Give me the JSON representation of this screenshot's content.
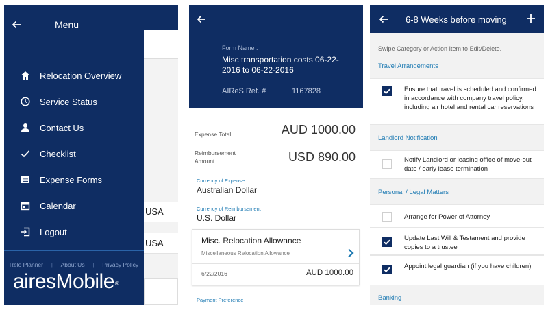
{
  "screen1": {
    "menu_title": "Menu",
    "menu_items": [
      {
        "label": "Relocation Overview",
        "icon": "home-icon"
      },
      {
        "label": "Service Status",
        "icon": "clock-icon"
      },
      {
        "label": "Contact Us",
        "icon": "person-icon"
      },
      {
        "label": "Checklist",
        "icon": "check-icon"
      },
      {
        "label": "Expense Forms",
        "icon": "list-icon"
      },
      {
        "label": "Calendar",
        "icon": "calendar-icon"
      },
      {
        "label": "Logout",
        "icon": "logout-icon"
      }
    ],
    "footer_links": [
      "Relo Planner",
      "About Us",
      "Privacy Policy"
    ],
    "brand": "airesMobile",
    "brand_mark": "®",
    "background_rows": [
      "USA",
      "USA"
    ]
  },
  "screen2": {
    "form_name_label": "Form Name :",
    "form_name": "Misc transportation costs 06-22-2016 to 06-22-2016",
    "ref_label": "AIReS Ref. #",
    "ref_value": "1167828",
    "expense_total_label": "Expense Total",
    "expense_total_value": "AUD 1000.00",
    "reimbursement_label": "Reimbursement Amount",
    "reimbursement_value": "USD 890.00",
    "currency_expense_label": "Currency of Expense",
    "currency_expense_value": "Australian Dollar",
    "currency_reimb_label": "Currency of Reimbursement",
    "currency_reimb_value": "U.S. Dollar",
    "card": {
      "title": "Misc. Relocation Allowance",
      "subtitle": "Miscellaneous Relocation Allowance",
      "date": "6/22/2016",
      "amount": "AUD 1000.00"
    },
    "payment_preference_label": "Payment Preference"
  },
  "screen3": {
    "title": "6-8 Weeks before moving",
    "hint": "Swipe Category or Action Item to Edit/Delete.",
    "categories": [
      {
        "name": "Travel Arrangements",
        "items": [
          {
            "text": "Ensure that travel is scheduled and confirmed in accordance with company travel policy, including air hotel and rental car reservations",
            "checked": true
          }
        ]
      },
      {
        "name": "Landlord Notification",
        "items": [
          {
            "text": "Notify Landlord or leasing office of move-out date / early lease termination",
            "checked": false
          }
        ]
      },
      {
        "name": "Personal / Legal Matters",
        "items": [
          {
            "text": "Arrange for Power of Attorney",
            "checked": false
          },
          {
            "text": "Update Last Will & Testament and provide copies to a trustee",
            "checked": true
          },
          {
            "text": "Appoint legal guardian (if you have children)",
            "checked": true
          }
        ]
      },
      {
        "name": "Banking",
        "items": []
      }
    ]
  },
  "colors": {
    "navy": "#0f2d63",
    "accent": "#1f7bb3"
  }
}
